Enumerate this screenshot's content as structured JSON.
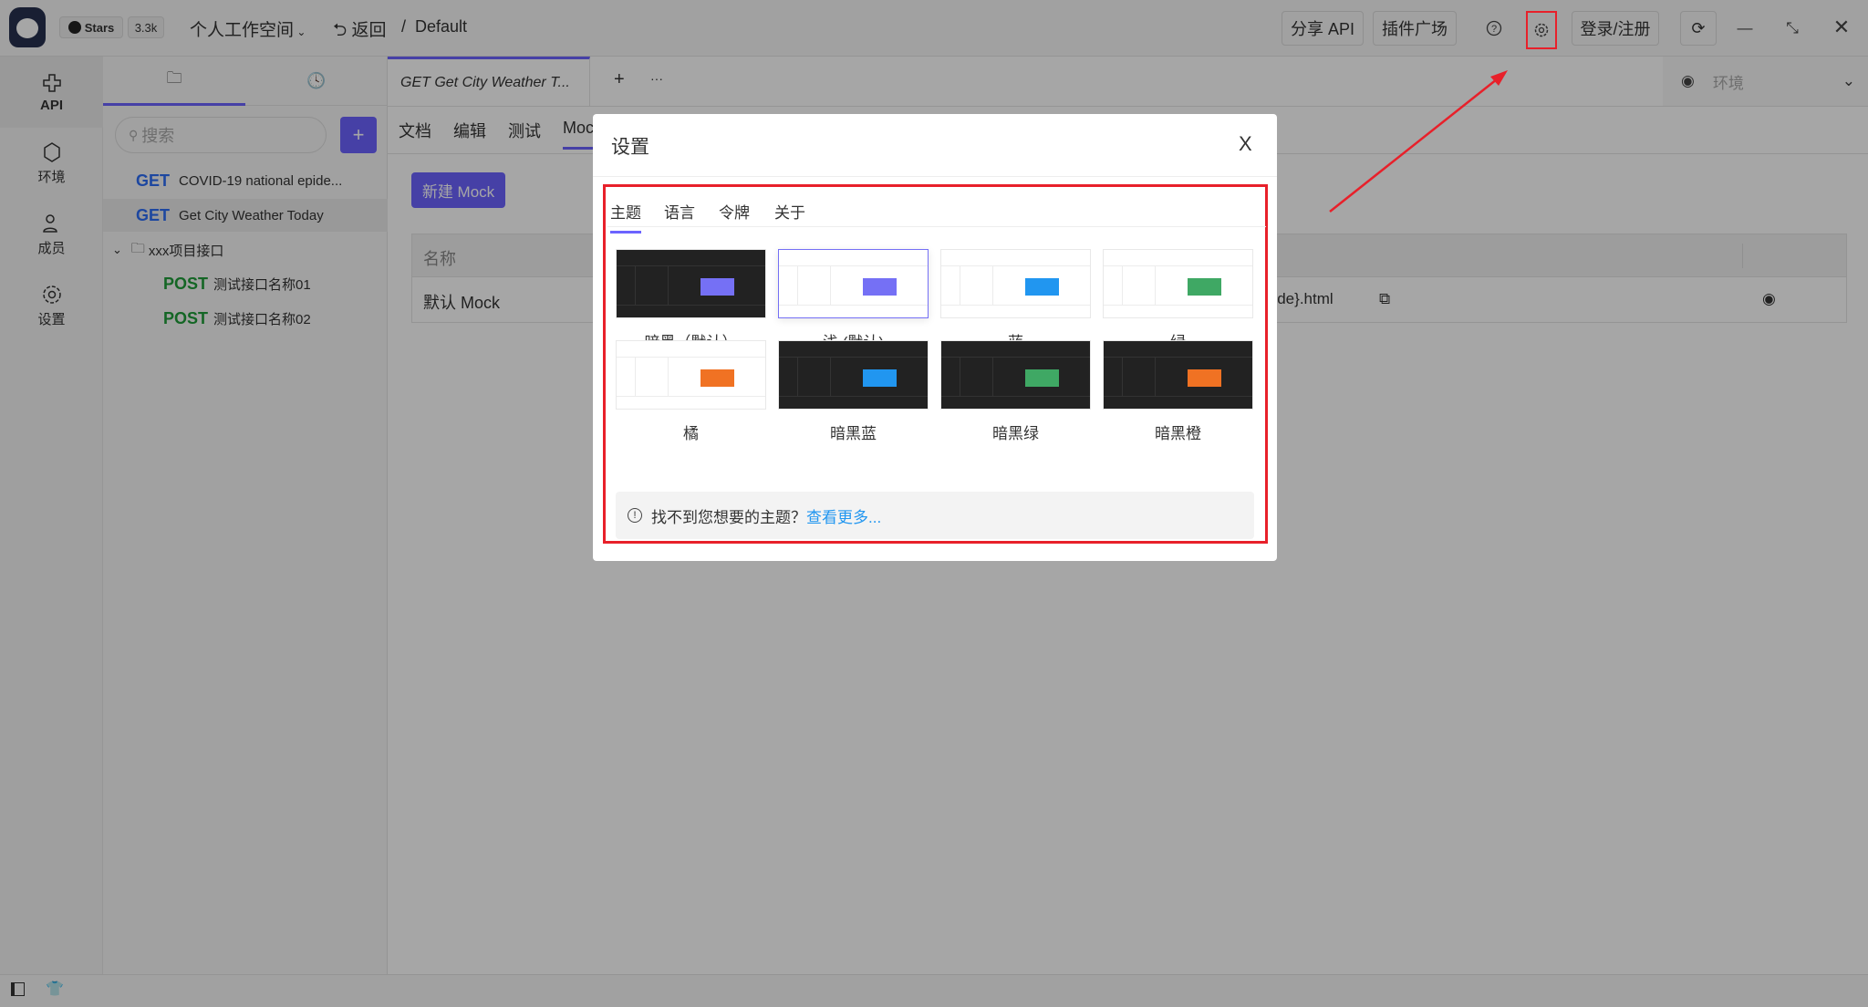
{
  "topbar": {
    "stars_label": "Stars",
    "stars_count": "3.3k",
    "workspace": "个人工作空间",
    "back": "返回",
    "separator": "/",
    "project": "Default",
    "share_api": "分享 API",
    "plugins": "插件广场",
    "login": "登录/注册"
  },
  "rail": {
    "items": [
      {
        "label": "API",
        "icon": "api-icon"
      },
      {
        "label": "环境",
        "icon": "environment-icon"
      },
      {
        "label": "成员",
        "icon": "members-icon"
      },
      {
        "label": "设置",
        "icon": "settings-icon"
      }
    ]
  },
  "sidebar": {
    "search_placeholder": "搜索",
    "add_label": "+",
    "items": [
      {
        "method": "GET",
        "name": "COVID-19 national epide..."
      },
      {
        "method": "GET",
        "name": "Get City Weather Today"
      },
      {
        "folder": "xxx项目接口"
      },
      {
        "method": "POST",
        "name": "测试接口名称01"
      },
      {
        "method": "POST",
        "name": "测试接口名称02"
      }
    ]
  },
  "main": {
    "tab": "GET Get City Weather T...",
    "add_tab": "+",
    "more": "···",
    "env_placeholder": "环境",
    "subtabs": [
      "文档",
      "编辑",
      "测试",
      "Mock"
    ],
    "new_mock": "新建 Mock",
    "table": {
      "headers": [
        "名称"
      ],
      "rows": [
        {
          "name": "默认 Mock",
          "url": "yCode}.html"
        }
      ]
    }
  },
  "modal": {
    "title": "设置",
    "close": "X",
    "tabs": [
      "主题",
      "语言",
      "令牌",
      "关于"
    ],
    "themes": [
      {
        "label": "暗黑（默认）",
        "mode": "dark",
        "color": "#7570f5"
      },
      {
        "label": "浅 (默认)",
        "mode": "light",
        "color": "#7570f5",
        "selected": true
      },
      {
        "label": "蓝",
        "mode": "light",
        "color": "#2196f0"
      },
      {
        "label": "绿",
        "mode": "light",
        "color": "#3fa864"
      },
      {
        "label": "橘",
        "mode": "light",
        "color": "#f07223"
      },
      {
        "label": "暗黑蓝",
        "mode": "dark",
        "color": "#2196f0"
      },
      {
        "label": "暗黑绿",
        "mode": "dark",
        "color": "#3fa864"
      },
      {
        "label": "暗黑橙",
        "mode": "dark",
        "color": "#f07223"
      }
    ],
    "footer_text": "找不到您想要的主题？",
    "footer_link": "查看更多..."
  },
  "colors": {
    "primary": "#6c63ff",
    "annotation": "#e8202a",
    "link": "#2196f0"
  }
}
